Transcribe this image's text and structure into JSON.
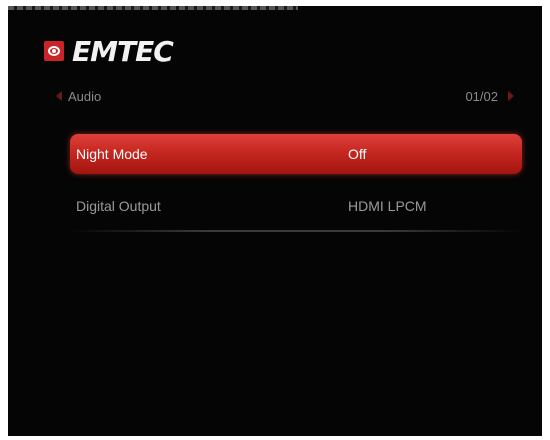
{
  "brand": {
    "name": "EMTEC"
  },
  "menu": {
    "title": "Audio",
    "page_indicator": "01/02",
    "items": [
      {
        "label": "Night Mode",
        "value": "Off",
        "selected": true
      },
      {
        "label": "Digital Output",
        "value": "HDMI LPCM",
        "selected": false
      }
    ]
  },
  "colors": {
    "highlight": "#c62720",
    "background": "#050505",
    "text_dim": "#9a9a9a"
  },
  "icons": {
    "back": "chevron-left-icon",
    "next": "chevron-right-icon",
    "logo": "emtec-logo-icon"
  }
}
